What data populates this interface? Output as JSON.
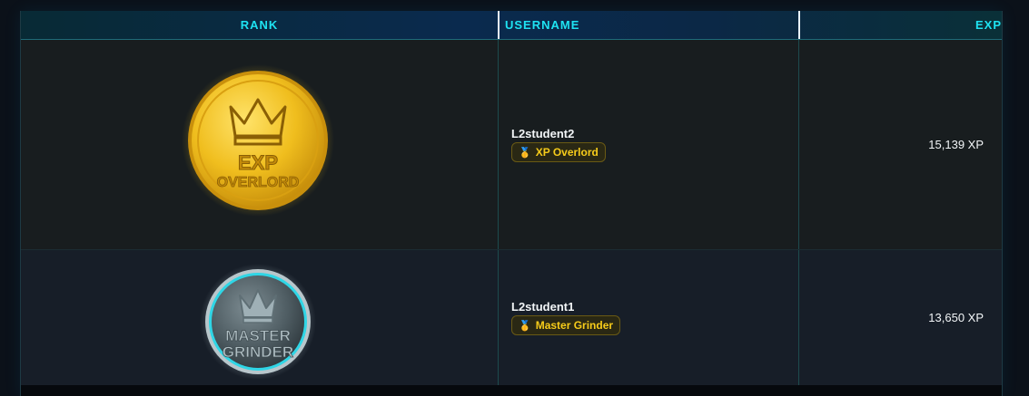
{
  "table": {
    "headers": {
      "rank": "RANK",
      "username": "USERNAME",
      "exp": "EXP"
    },
    "rows": [
      {
        "medal_line1": "EXP",
        "medal_line2": "OVERLORD",
        "medal_icon": "crown-icon",
        "username": "L2student2",
        "badge_icon": "medal-icon",
        "badge": "XP Overlord",
        "exp": "15,139 XP"
      },
      {
        "medal_line1": "MASTER",
        "medal_line2": "GRINDER",
        "medal_icon": "crown-icon",
        "username": "L2student1",
        "badge_icon": "medal-icon",
        "badge": "Master Grinder",
        "exp": "13,650 XP"
      }
    ]
  },
  "colors": {
    "header_text": "#1ee3f2",
    "badge_text": "#f7cc1a",
    "gold_medal": "#e2b11c",
    "silver_medal": "#7f8f95",
    "silver_ring": "#2fd6e6"
  }
}
